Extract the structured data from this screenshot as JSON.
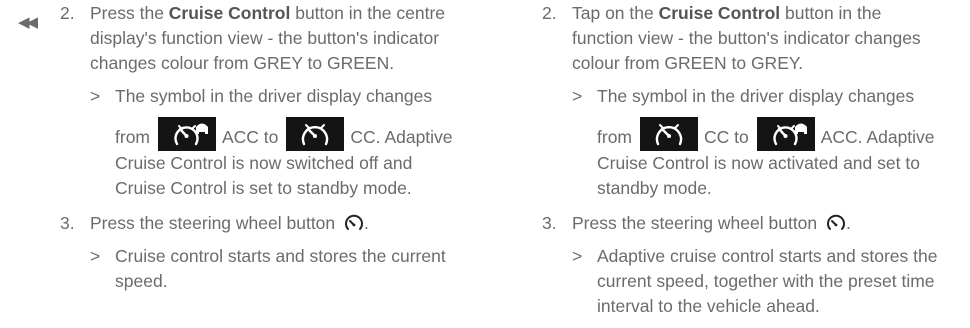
{
  "left": {
    "cont_marker": "◀◀",
    "step2": {
      "number": "2.",
      "pre": "Press the ",
      "bold": "Cruise Control",
      "post": " button in the centre display's function view - the button's indicator changes colour from GREY to GREEN."
    },
    "result1": {
      "marker": ">",
      "text1": "The symbol in the driver display changes",
      "from": "from",
      "label_a": "ACC to",
      "label_b": "CC. Adaptive Cruise Control is now switched off and Cruise Control is set to standby mode."
    },
    "step3": {
      "number": "3.",
      "text": "Press the steering wheel button",
      "after": "."
    },
    "result2": {
      "marker": ">",
      "text": "Cruise control starts and stores the current speed."
    }
  },
  "right": {
    "step2": {
      "number": "2.",
      "pre": "Tap on the ",
      "bold": "Cruise Control",
      "post": " button in the function view - the button's indicator changes colour from GREEN to GREY."
    },
    "result1": {
      "marker": ">",
      "text1": "The symbol in the driver display changes",
      "from": "from",
      "label_a": "CC to",
      "label_b": "ACC. Adaptive Cruise Control is now activated and set to standby mode."
    },
    "step3": {
      "number": "3.",
      "text": "Press the steering wheel button",
      "after": "."
    },
    "result2": {
      "marker": ">",
      "text": "Adaptive cruise control starts and stores the current speed, together with the preset time interval to the vehicle ahead."
    }
  },
  "icons": {
    "acc": "acc-symbol-icon",
    "cc": "cc-symbol-icon",
    "wheel_button": "speedometer-button-icon"
  }
}
